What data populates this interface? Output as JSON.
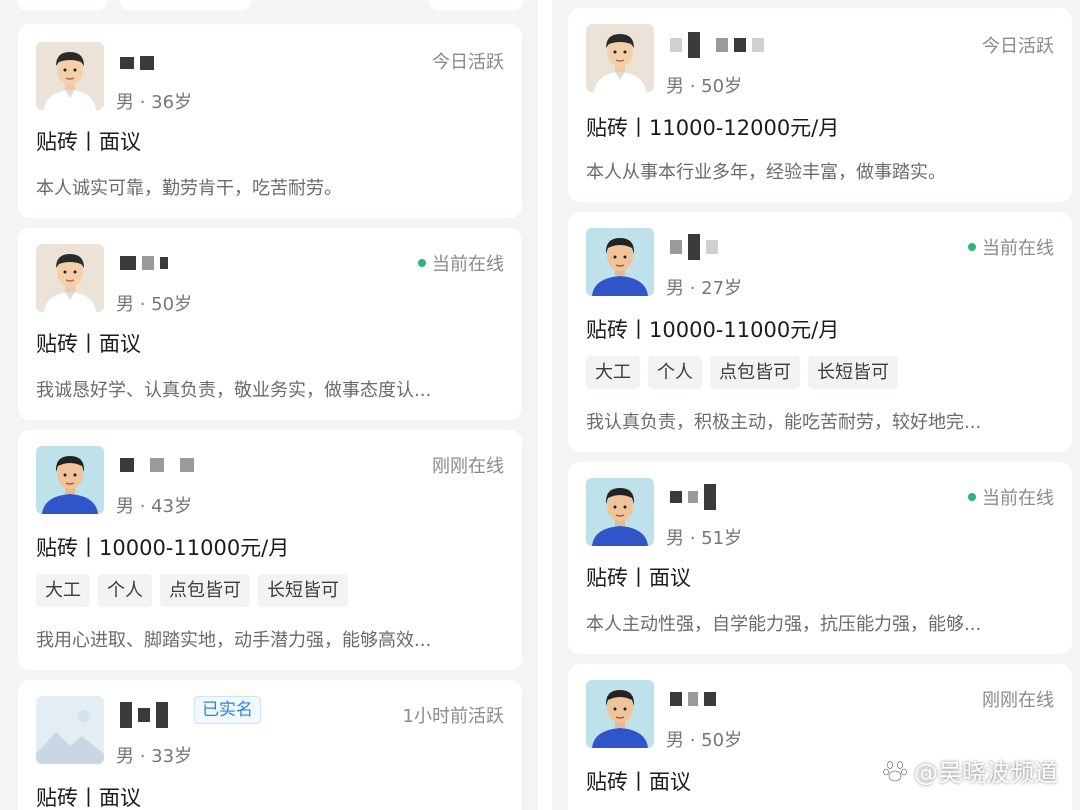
{
  "left_cards": [
    {
      "status": "今日活跃",
      "meta": "男 · 36岁",
      "job": "贴砖丨面议",
      "desc": "本人诚实可靠，勤劳肯干，吃苦耐劳。"
    },
    {
      "status": "当前在线",
      "meta": "男 · 50岁",
      "job": "贴砖丨面议",
      "desc": "我诚恳好学、认真负责，敬业务实，做事态度认..."
    },
    {
      "status": "刚刚在线",
      "meta": "男 · 43岁",
      "job": "贴砖丨10000-11000元/月",
      "tags": [
        "大工",
        "个人",
        "点包皆可",
        "长短皆可"
      ],
      "desc": "我用心进取、脚踏实地，动手潜力强，能够高效..."
    },
    {
      "status": "1小时前活跃",
      "verified": "已实名",
      "meta": "男 · 33岁",
      "job": "贴砖丨面议"
    }
  ],
  "right_cards": [
    {
      "status": "今日活跃",
      "meta": "男 · 50岁",
      "job": "贴砖丨11000-12000元/月",
      "desc": "本人从事本行业多年，经验丰富，做事踏实。"
    },
    {
      "status": "当前在线",
      "meta": "男 · 27岁",
      "job": "贴砖丨10000-11000元/月",
      "tags": [
        "大工",
        "个人",
        "点包皆可",
        "长短皆可"
      ],
      "desc": "我认真负责，积极主动，能吃苦耐劳，较好地完..."
    },
    {
      "status": "当前在线",
      "meta": "男 · 51岁",
      "job": "贴砖丨面议",
      "desc": "本人主动性强，自学能力强，抗压能力强，能够..."
    },
    {
      "status": "刚刚在线",
      "meta": "男 · 50岁",
      "job": "贴砖丨面议"
    }
  ],
  "watermark": "@吴晓波频道",
  "colors": {
    "online_dot": "#2bb673",
    "verified_text": "#2a86d8"
  }
}
